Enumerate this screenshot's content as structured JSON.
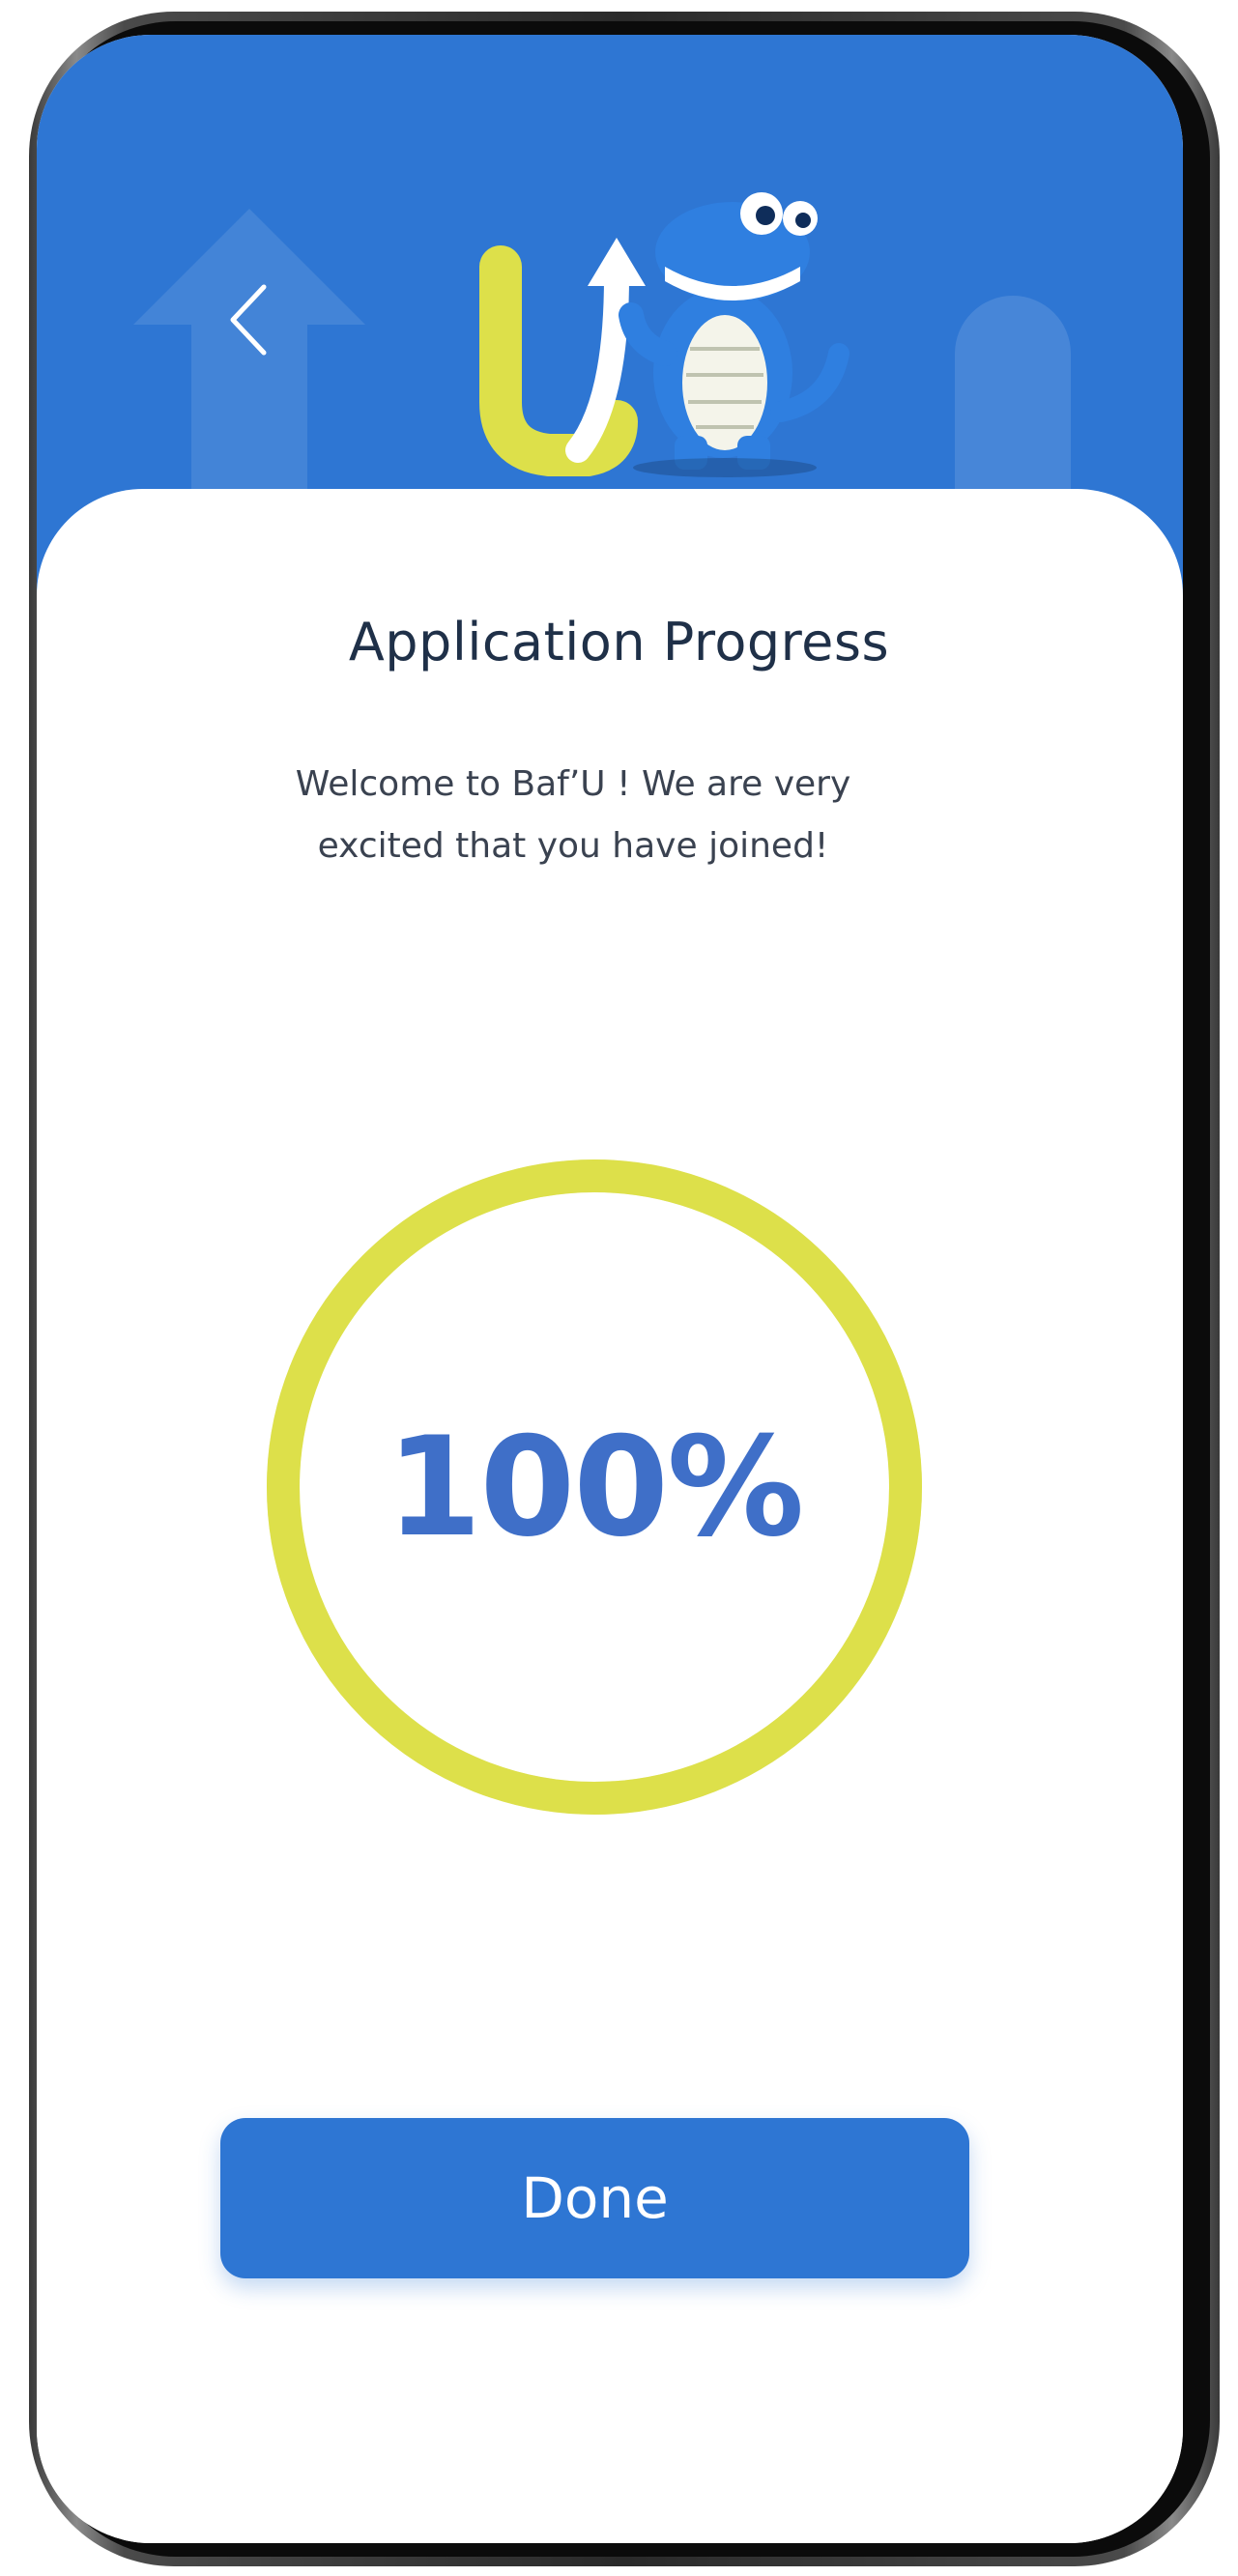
{
  "header": {
    "back_icon": "chevron-left-icon",
    "logo": "bafu-logo-crocodile",
    "brand_color": "#2E76D3",
    "accent_color": "#DDE04A"
  },
  "main": {
    "title": "Application Progress",
    "subtitle": "Welcome to Baf’U !  We are very excited that you have joined!",
    "progress": {
      "value": 100,
      "label": "100%",
      "ring_color": "#DDE04A",
      "text_color": "#3F6FC8"
    },
    "done_button": {
      "label": "Done"
    }
  }
}
